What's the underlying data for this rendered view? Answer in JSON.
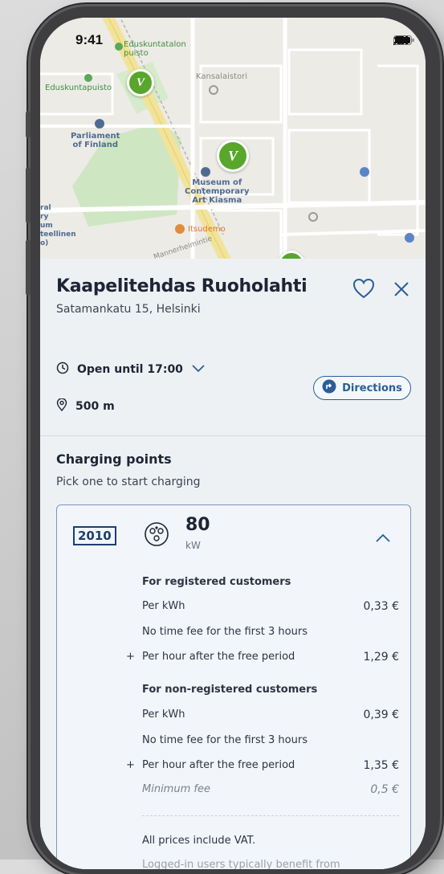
{
  "status": {
    "time": "9:41"
  },
  "map": {
    "labels": {
      "eduskuntatalon_puisto": [
        "Eduskuntatalon",
        "puisto"
      ],
      "eduskuntapuisto": "Eduskuntapuisto",
      "kansalaistori": "Kansalaistori",
      "parliament": [
        "Parliament",
        "of Finland"
      ],
      "museum": [
        "Museum of",
        "Contemporary",
        "Art Kiasma"
      ],
      "itsudemo": "Itsudemo",
      "edge": [
        "ral",
        "ry",
        "um",
        "teellinen",
        "o)"
      ],
      "street": "Mannerheimintie"
    },
    "pin_glyph": "V"
  },
  "station": {
    "name": "Kaapelitehdas Ruoholahti",
    "address": "Satamankatu 15, Helsinki",
    "hours": "Open until 17:00",
    "distance": "500 m",
    "directions_label": "Directions"
  },
  "charging": {
    "title": "Charging points",
    "subtitle": "Pick one to start charging",
    "point": {
      "id": "2010",
      "power": "80",
      "unit": "kW",
      "registered": {
        "heading": "For registered customers",
        "per_kwh_label": "Per kWh",
        "per_kwh_value": "0,33 €",
        "free_note": "No time fee for the first 3 hours",
        "per_hour_label": "Per hour after the free period",
        "per_hour_value": "1,29 €"
      },
      "non_registered": {
        "heading": "For non-registered customers",
        "per_kwh_label": "Per kWh",
        "per_kwh_value": "0,39 €",
        "free_note": "No time fee for the first 3 hours",
        "per_hour_label": "Per hour after the free period",
        "per_hour_value": "1,35 €",
        "min_fee_label": "Minimum fee",
        "min_fee_value": "0,5 €"
      },
      "vat_note": "All prices include VAT.",
      "footnote": "Logged-in users typically benefit from"
    }
  },
  "colors": {
    "accent": "#2a5e99",
    "pin_green": "#58a62c",
    "title": "#1d2535"
  }
}
